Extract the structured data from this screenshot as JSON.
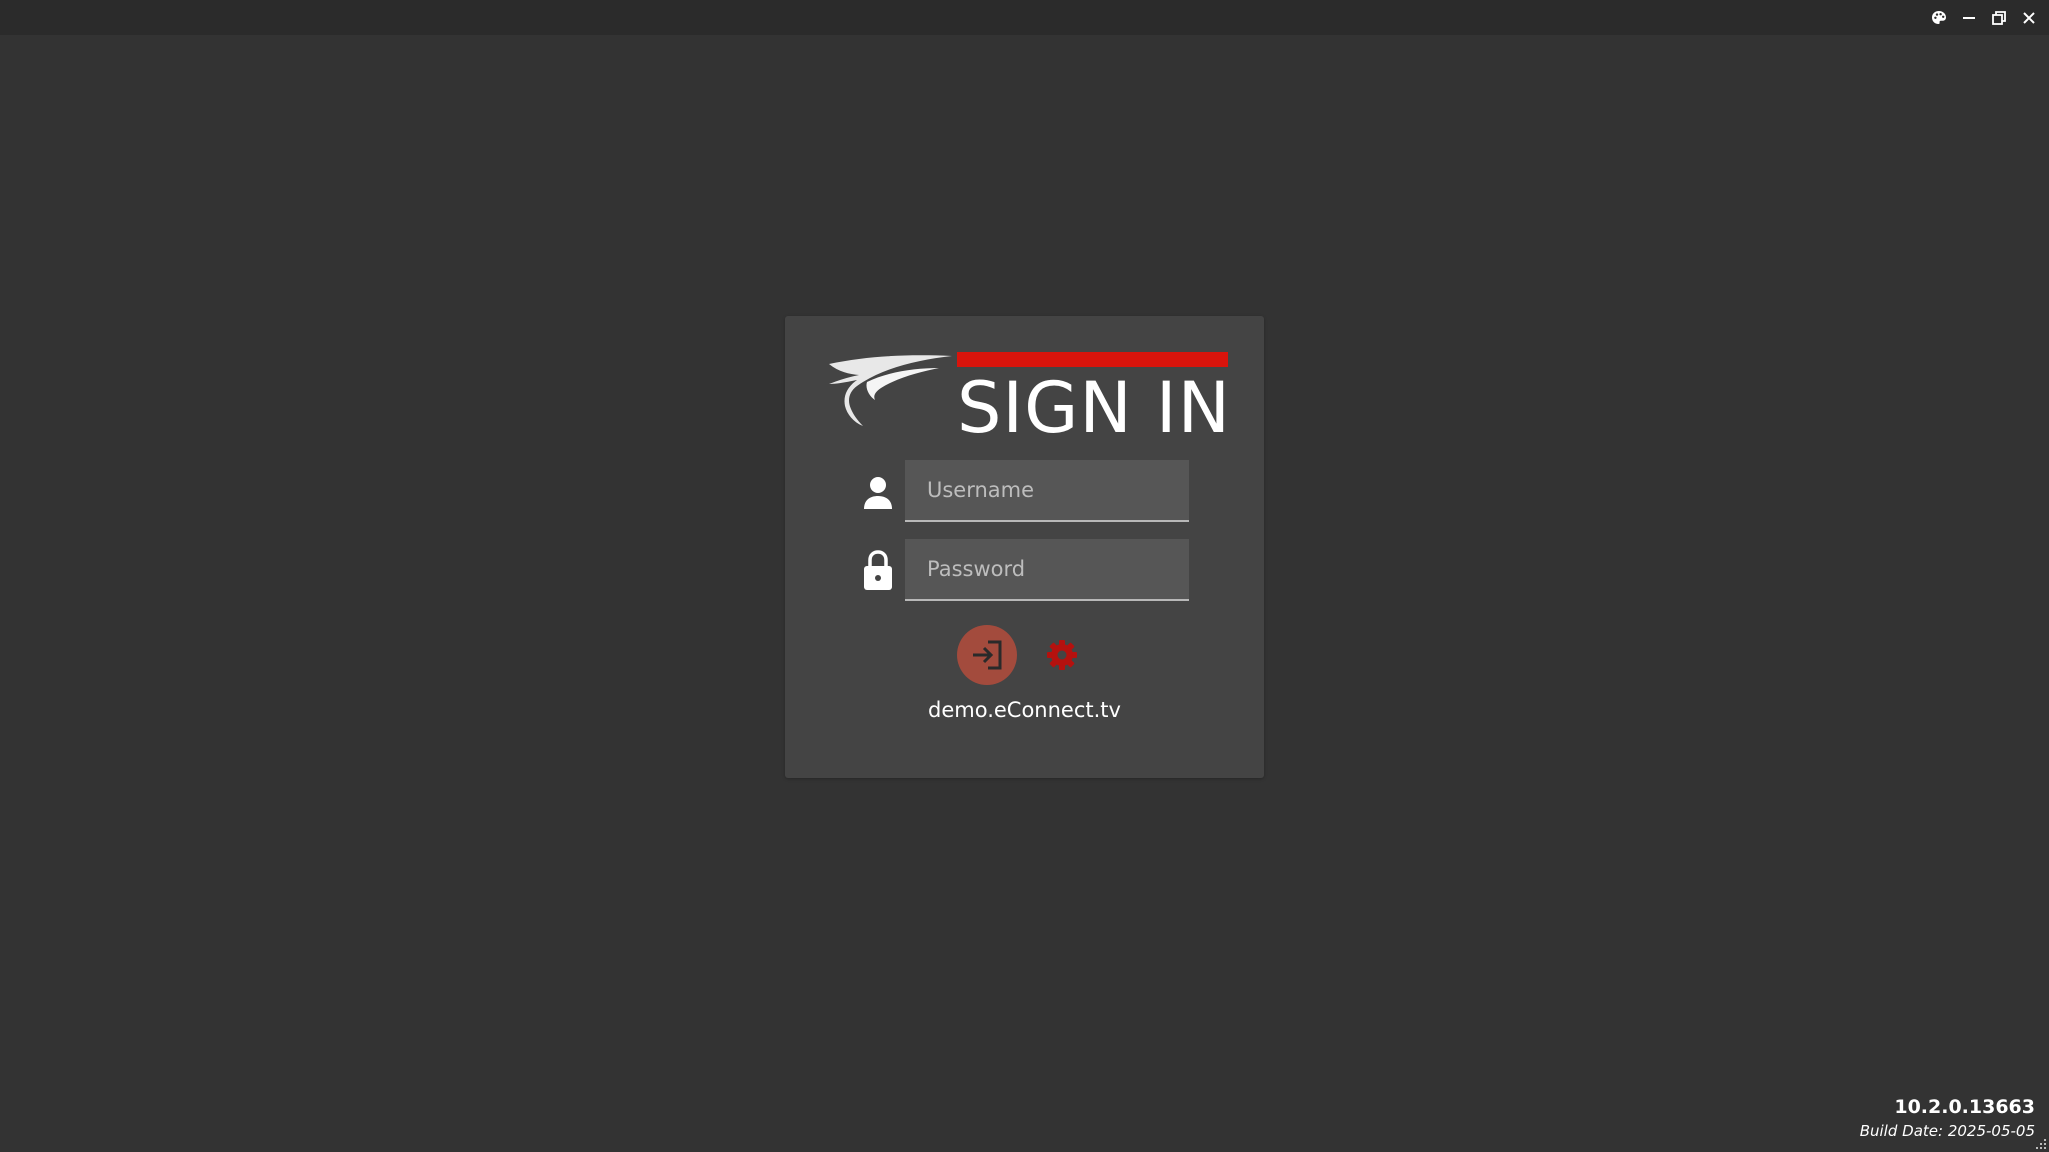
{
  "titlebar": {
    "controls": [
      {
        "name": "theme",
        "icon": "palette-icon"
      },
      {
        "name": "minimize",
        "icon": "minimize-icon"
      },
      {
        "name": "restore",
        "icon": "restore-icon"
      },
      {
        "name": "close",
        "icon": "close-icon"
      }
    ]
  },
  "login": {
    "title": "SIGN IN",
    "logo_icon": "swoosh-logo-icon",
    "accent_color": "#d9140c",
    "username": {
      "placeholder": "Username",
      "value": "",
      "icon": "user-icon"
    },
    "password": {
      "placeholder": "Password",
      "value": "",
      "icon": "lock-icon"
    },
    "signin_button": {
      "icon": "sign-in-arrow-icon",
      "color": "#a34b3d"
    },
    "settings_button": {
      "icon": "gear-icon",
      "color": "#b5110e"
    },
    "server": "demo.eConnect.tv"
  },
  "footer": {
    "version": "10.2.0.13663",
    "build_date": "Build Date: 2025-05-05"
  }
}
